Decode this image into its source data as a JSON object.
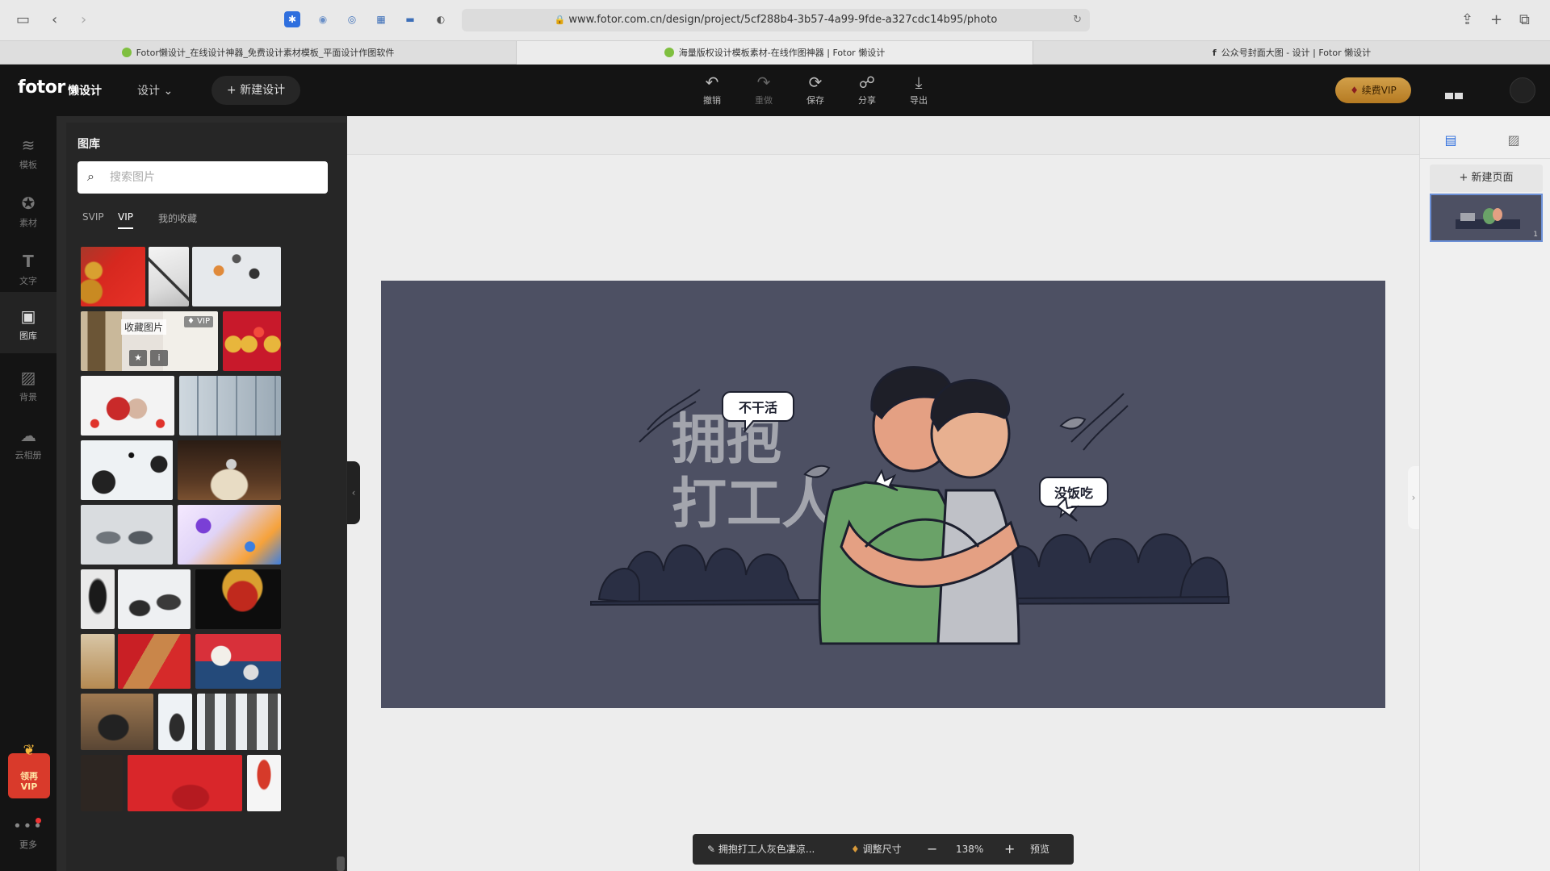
{
  "browser": {
    "url": "www.fotor.com.cn/design/project/5cf288b4-3b57-4a99-9fde-a327cdc14b95/photo",
    "tabs": [
      {
        "label": "Fotor懒设计_在线设计神器_免费设计素材模板_平面设计作图软件"
      },
      {
        "label": "海量版权设计模板素材-在线作图神器 | Fotor 懒设计"
      },
      {
        "label": "公众号封面大图 - 设计 | Fotor 懒设计"
      }
    ]
  },
  "header": {
    "logo": "fotor",
    "logo_sub": "懒设计",
    "design_menu": "设计",
    "new_design": "新建设计",
    "tools": {
      "undo": "撤销",
      "redo": "重做",
      "save": "保存",
      "share": "分享",
      "export": "导出"
    },
    "renew_vip": "续费VIP"
  },
  "nav": {
    "templates": "模板",
    "elements": "素材",
    "text": "文字",
    "gallery": "图库",
    "background": "背景",
    "cloud": "云相册",
    "more": "更多",
    "gift_line1": "领再",
    "gift_line2": "VIP"
  },
  "library": {
    "title": "图库",
    "search_placeholder": "搜索图片",
    "tabs": {
      "svip": "SVIP",
      "vip": "VIP",
      "favorites": "我的收藏"
    },
    "hover_label": "收藏图片",
    "vip_badge": "VIP"
  },
  "artwork": {
    "title_line1": "拥抱",
    "title_line2": "打工人",
    "bubble_left": "不干活",
    "bubble_right": "没饭吃"
  },
  "bottom_bar": {
    "project_name": "拥抱打工人灰色凄凉...",
    "resize": "调整尺寸",
    "zoom": "138%",
    "preview": "预览"
  },
  "right_panel": {
    "new_page": "新建页面",
    "page_number": "1"
  },
  "colors": {
    "header_bg": "#141414",
    "panel_bg": "#262626",
    "artboard_bg": "#4d5063",
    "vip_gold": "#c48d35",
    "gift_red": "#d93a2b"
  }
}
